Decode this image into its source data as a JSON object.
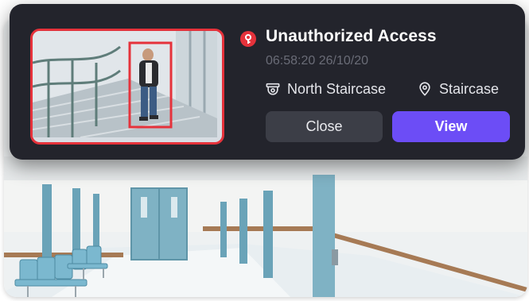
{
  "alert": {
    "title": "Unauthorized Access",
    "timestamp": "06:58:20 26/10/20",
    "camera": "North Staircase",
    "location": "Staircase",
    "close_label": "Close",
    "view_label": "View"
  },
  "icons": {
    "alert": "alert-badge-icon",
    "camera": "camera-icon",
    "location": "location-pin-icon"
  },
  "colors": {
    "card_bg": "#23242c",
    "alert_red": "#e5323b",
    "view_button": "#6c4df6",
    "close_button": "#3c3e47",
    "timestamp_text": "#6a6c77"
  }
}
